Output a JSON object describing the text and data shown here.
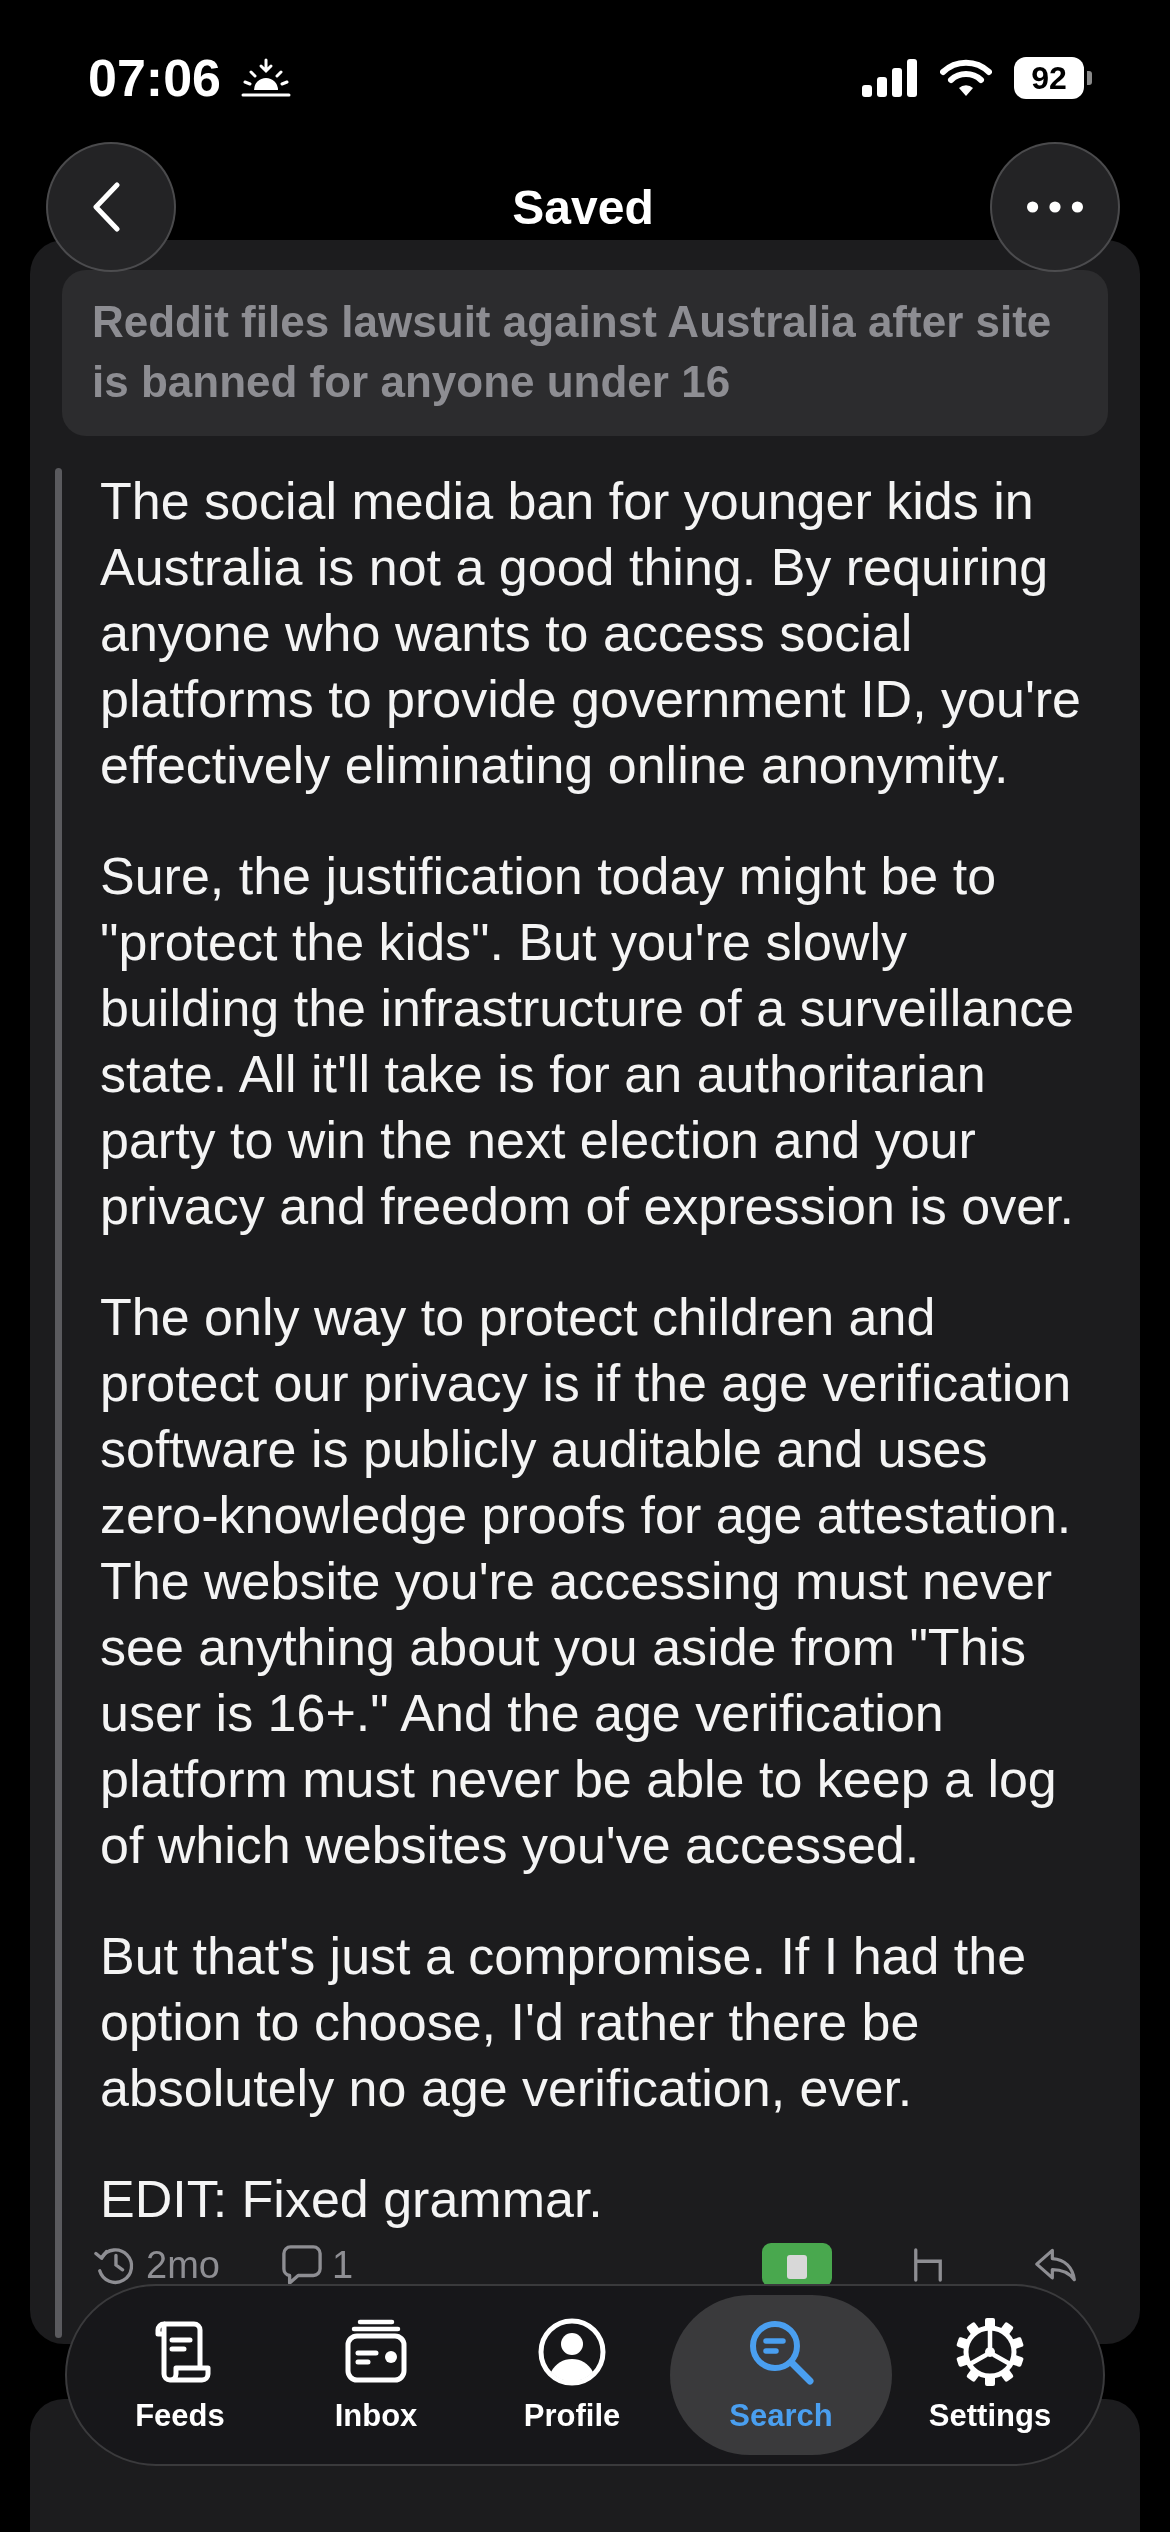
{
  "status_bar": {
    "time": "07:06",
    "battery": "92"
  },
  "header": {
    "title": "Saved"
  },
  "post_title": "Reddit files lawsuit against Australia after site is banned for anyone under 16",
  "comment": {
    "paragraphs": [
      "The social media ban for younger kids in Australia is not a good thing. By requiring anyone who wants to access social platforms to provide government ID, you're effectively eliminating online anonymity.",
      "Sure, the justification today might be to \"protect the kids\". But you're slowly building the infrastructure of a surveillance state. All it'll take is for an authoritarian party to win the next election and your privacy and freedom of expression is over.",
      "The only way to protect children and protect our privacy is if the age verification software is publicly auditable and uses zero-knowledge proofs for age attestation. The website you're accessing must never see anything about you aside from \"This user is 16+.\" And the age verification platform must never be able to keep a log of which websites you've accessed.",
      "But that's just a compromise. If I had the option to choose, I'd rather there be absolutely no age verification, ever.",
      "EDIT: Fixed grammar."
    ],
    "age": "2mo",
    "replies": "1"
  },
  "tab_bar": {
    "tabs": [
      {
        "kind": "feeds",
        "label": "Feeds",
        "selected": false
      },
      {
        "kind": "inbox",
        "label": "Inbox",
        "selected": false
      },
      {
        "kind": "profile",
        "label": "Profile",
        "selected": false
      },
      {
        "kind": "search",
        "label": "Search",
        "selected": true
      },
      {
        "kind": "settings",
        "label": "Settings",
        "selected": false
      }
    ]
  }
}
